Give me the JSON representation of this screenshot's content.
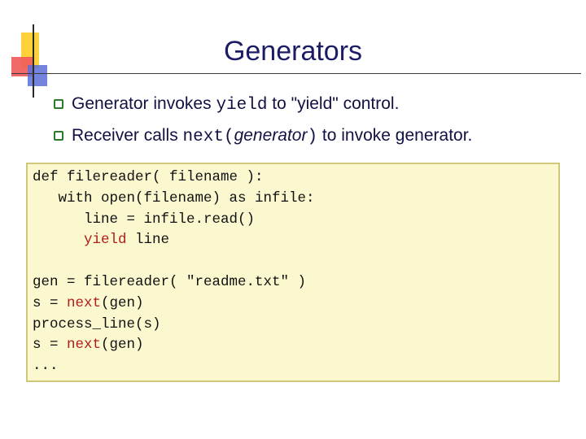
{
  "slide": {
    "title": "Generators",
    "bullets": [
      {
        "pre": "Generator invokes ",
        "code": "yield",
        "post": " to \"yield\" control."
      },
      {
        "pre": "Receiver calls ",
        "code": "next(",
        "italic": "generator",
        "code2": ")",
        "post": " to invoke generator."
      }
    ]
  },
  "code": {
    "lines": [
      {
        "parts": [
          {
            "t": "def filereader( filename ):",
            "hl": false
          }
        ]
      },
      {
        "parts": [
          {
            "t": "   with open(filename) as infile:",
            "hl": false
          }
        ]
      },
      {
        "parts": [
          {
            "t": "      line = infile.read()",
            "hl": false
          }
        ]
      },
      {
        "parts": [
          {
            "t": "      ",
            "hl": false
          },
          {
            "t": "yield",
            "hl": true
          },
          {
            "t": " line",
            "hl": false
          }
        ]
      },
      {
        "parts": [
          {
            "t": "",
            "hl": false
          }
        ]
      },
      {
        "parts": [
          {
            "t": "gen = filereader( \"readme.txt\" )",
            "hl": false
          }
        ]
      },
      {
        "parts": [
          {
            "t": "s = ",
            "hl": false
          },
          {
            "t": "next",
            "hl": true
          },
          {
            "t": "(gen)",
            "hl": false
          }
        ]
      },
      {
        "parts": [
          {
            "t": "process_line(s)",
            "hl": false
          }
        ]
      },
      {
        "parts": [
          {
            "t": "s = ",
            "hl": false
          },
          {
            "t": "next",
            "hl": true
          },
          {
            "t": "(gen)",
            "hl": false
          }
        ]
      },
      {
        "parts": [
          {
            "t": "...",
            "hl": false
          }
        ]
      }
    ],
    "highlight_color": "#b11c1c",
    "background_color": "#fbf8cf"
  }
}
